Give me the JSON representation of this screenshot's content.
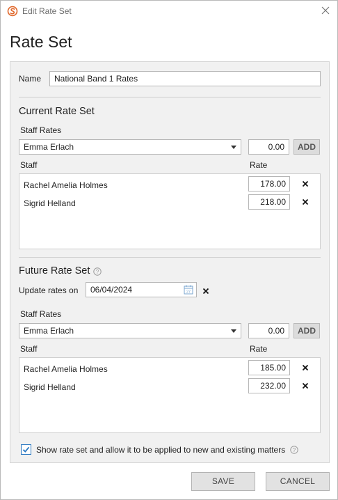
{
  "window": {
    "title": "Edit Rate Set"
  },
  "page": {
    "title": "Rate Set"
  },
  "name_field": {
    "label": "Name",
    "value": "National Band 1 Rates"
  },
  "current": {
    "title": "Current Rate Set",
    "staff_rates_label": "Staff Rates",
    "selected_staff": "Emma Erlach",
    "new_rate": "0.00",
    "add_label": "ADD",
    "col_staff": "Staff",
    "col_rate": "Rate",
    "rows": [
      {
        "name": "Rachel Amelia Holmes",
        "rate": "178.00"
      },
      {
        "name": "Sigrid Helland",
        "rate": "218.00"
      }
    ]
  },
  "future": {
    "title": "Future Rate Set",
    "update_label": "Update rates on",
    "update_date": "06/04/2024",
    "staff_rates_label": "Staff Rates",
    "selected_staff": "Emma Erlach",
    "new_rate": "0.00",
    "add_label": "ADD",
    "col_staff": "Staff",
    "col_rate": "Rate",
    "rows": [
      {
        "name": "Rachel Amelia Holmes",
        "rate": "185.00"
      },
      {
        "name": "Sigrid Helland",
        "rate": "232.00"
      }
    ]
  },
  "show_option": {
    "label": "Show rate set and allow it to be applied to new and existing matters",
    "checked": true
  },
  "footer": {
    "save_label": "SAVE",
    "cancel_label": "CANCEL"
  },
  "colors": {
    "accent": "#2b79c2",
    "logo": "#e0672a",
    "panel_bg": "#f1f1f1"
  }
}
